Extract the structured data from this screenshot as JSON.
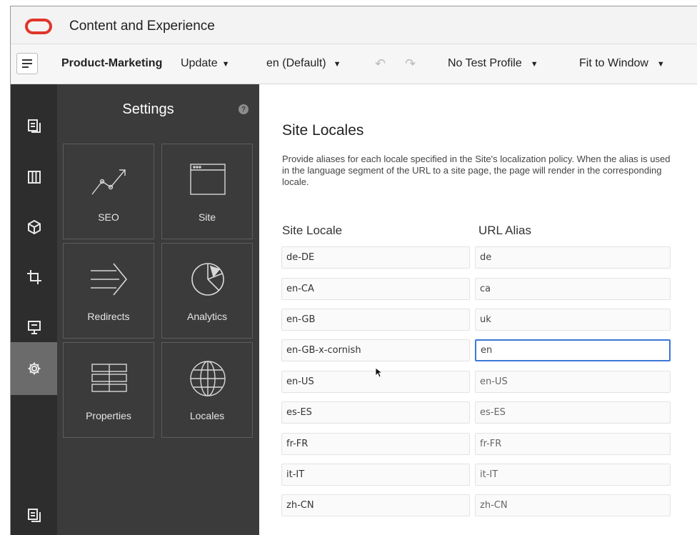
{
  "app": {
    "title": "Content and Experience"
  },
  "toolbar": {
    "site_name": "Product-Marketing",
    "update_label": "Update",
    "locale_label": "en (Default)",
    "test_profile_label": "No Test Profile",
    "fit_label": "Fit to Window"
  },
  "rail": {
    "items": [
      "pages-icon",
      "components-icon",
      "themes-icon",
      "crop-icon",
      "publish-icon",
      "settings-icon",
      "bottom-pages-icon"
    ],
    "active": "settings-icon"
  },
  "settings_panel": {
    "title": "Settings",
    "help": "?",
    "tiles": [
      {
        "label": "SEO",
        "icon": "seo-icon"
      },
      {
        "label": "Site",
        "icon": "site-icon"
      },
      {
        "label": "Redirects",
        "icon": "redirects-icon"
      },
      {
        "label": "Analytics",
        "icon": "analytics-icon"
      },
      {
        "label": "Properties",
        "icon": "properties-icon"
      },
      {
        "label": "Locales",
        "icon": "locales-icon"
      }
    ]
  },
  "main": {
    "title": "Site Locales",
    "description": "Provide aliases for each locale specified in the Site's localization policy. When the alias is used in the language segment of the URL to a site page, the page will render in the corresponding locale.",
    "col_locale": "Site Locale",
    "col_alias": "URL Alias",
    "rows": [
      {
        "locale": "de-DE",
        "alias": "de"
      },
      {
        "locale": "en-CA",
        "alias": "ca"
      },
      {
        "locale": "en-GB",
        "alias": "uk"
      },
      {
        "locale": "en-GB-x-cornish",
        "alias": "en"
      },
      {
        "locale": "en-US",
        "alias": "en-US"
      },
      {
        "locale": "es-ES",
        "alias": "es-ES"
      },
      {
        "locale": "fr-FR",
        "alias": "fr-FR"
      },
      {
        "locale": "it-IT",
        "alias": "it-IT"
      },
      {
        "locale": "zh-CN",
        "alias": "zh-CN"
      }
    ],
    "focused_row": 3
  },
  "colors": {
    "brand": "#e0352b",
    "rail_bg": "#2d2d2d",
    "panel_bg": "#3b3b3b",
    "focus": "#3b78d6"
  }
}
